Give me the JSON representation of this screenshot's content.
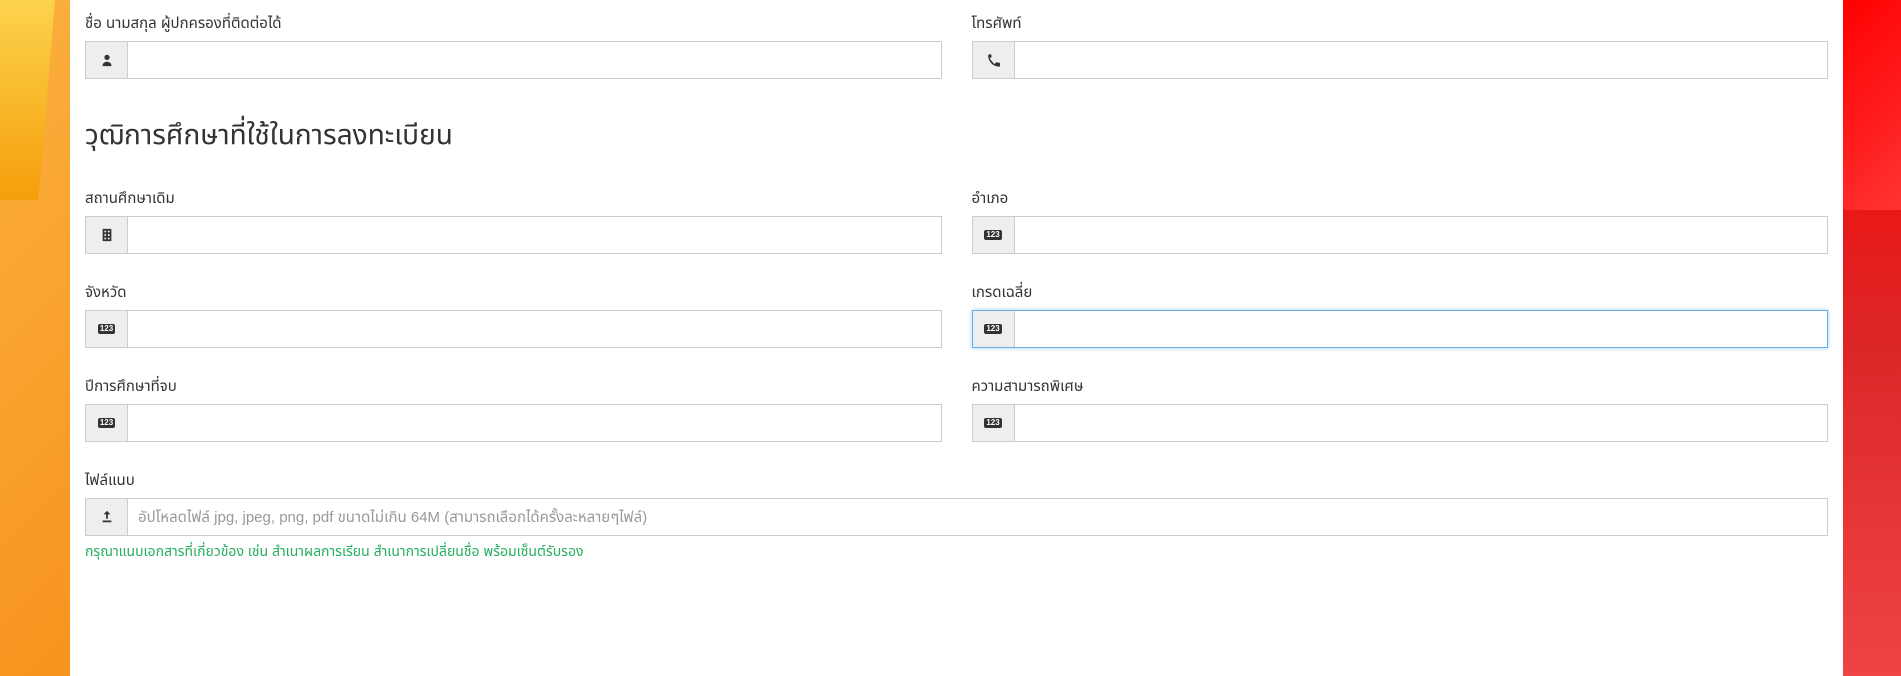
{
  "guardian": {
    "name_label": "ชื่อ นามสกุล ผู้ปกครองที่ติดต่อได้",
    "phone_label": "โทรศัพท์",
    "name_value": "",
    "phone_value": ""
  },
  "education": {
    "heading": "วุฒิการศึกษาที่ใช้ในการลงทะเบียน",
    "school_label": "สถานศึกษาเดิม",
    "school_value": "",
    "district_label": "อำเภอ",
    "district_value": "",
    "province_label": "จังหวัด",
    "province_value": "",
    "gpa_label": "เกรดเฉลี่ย",
    "gpa_value": "",
    "year_label": "ปีการศึกษาที่จบ",
    "year_value": "",
    "skill_label": "ความสามารถพิเศษ",
    "skill_value": "",
    "file_label": "ไฟล์แนบ",
    "file_placeholder": "อัปโหลดไฟล์ jpg, jpeg, png, pdf ขนาดไม่เกิน 64M (สามารถเลือกได้ครั้งละหลายๆไฟล์)",
    "file_help": "กรุณาแนบเอกสารที่เกี่ยวข้อง เช่น สำเนาผลการเรียน สำเนาการเปลี่ยนชื่อ พร้อมเซ็นต์รับรอง"
  },
  "icons": {
    "badge": "123"
  }
}
